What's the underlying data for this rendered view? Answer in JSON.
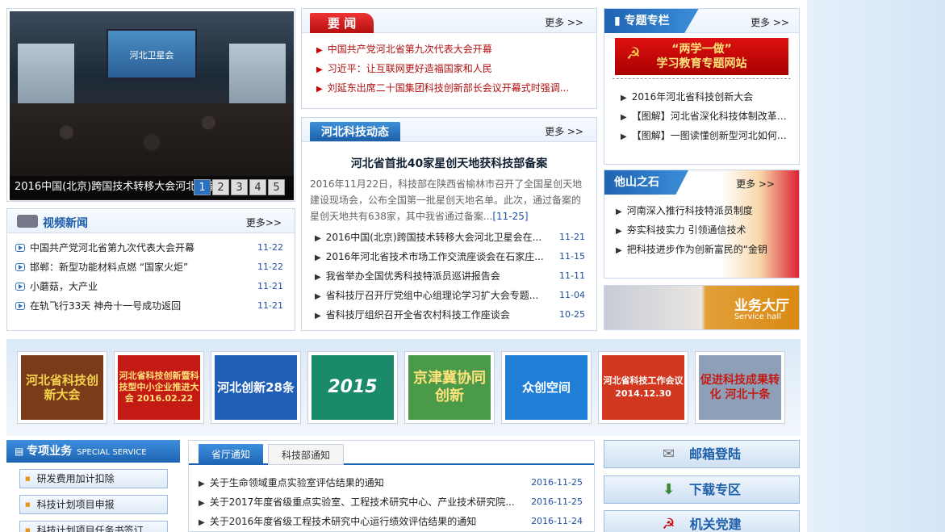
{
  "slideshow": {
    "stage_text": "河北卫星会",
    "caption": "2016中国(北京)跨国技术转移大会河北卫星会",
    "pages": [
      "1",
      "2",
      "3",
      "4",
      "5"
    ],
    "current": 1
  },
  "news": {
    "title": "要 闻",
    "more": "更多 >>",
    "items": [
      "中国共产党河北省第九次代表大会开幕",
      "习近平：让互联网更好造福国家和人民",
      "刘延东出席二十国集团科技创新部长会议开幕式时强调..."
    ]
  },
  "dynamics": {
    "title": "河北科技动态",
    "more": "更多 >>",
    "headline": "河北省首批40家星创天地获科技部备案",
    "summary": "2016年11月22日，科技部在陕西省榆林市召开了全国星创天地建设现场会，公布全国第一批星创天地名单。此次，通过备案的星创天地共有638家，其中我省通过备案...",
    "summary_date": "[11-25]",
    "items": [
      {
        "text": "2016中国(北京)跨国技术转移大会河北卫星会在...",
        "date": "11-21"
      },
      {
        "text": "2016年河北省技术市场工作交流座谈会在石家庄...",
        "date": "11-15"
      },
      {
        "text": "我省举办全国优秀科技特派员巡讲报告会",
        "date": "11-11"
      },
      {
        "text": "省科技厅召开厅党组中心组理论学习扩大会专题...",
        "date": "11-04"
      },
      {
        "text": "省科技厅组织召开全省农村科技工作座谈会",
        "date": "10-25"
      }
    ]
  },
  "video": {
    "title": "视频新闻",
    "more": "更多>>",
    "items": [
      {
        "text": "中国共产党河北省第九次代表大会开幕",
        "date": "11-22"
      },
      {
        "text": "邯郸：新型功能材料点燃 “国家火炬”",
        "date": "11-22"
      },
      {
        "text": "小蘑菇，大产业",
        "date": "11-21"
      },
      {
        "text": "在轨飞行33天 神舟十一号成功返回",
        "date": "11-21"
      }
    ]
  },
  "topic": {
    "title": "专题专栏",
    "banner_line1": "“两学一做”",
    "banner_line2": "学习教育专题网站",
    "more": "更多 >>",
    "items": [
      "2016年河北省科技创新大会",
      "【图解】河北省深化科技体制改革实...",
      "【图解】一图读懂创新型河北如何建..."
    ]
  },
  "stone": {
    "title": "他山之石",
    "more": "更多 >>",
    "items": [
      "河南深入推行科技特派员制度",
      "夯实科技实力 引领通信技术",
      "把科技进步作为创新富民的“金钥"
    ]
  },
  "hall": {
    "title": "业务大厅",
    "subtitle": "Service hall"
  },
  "thumbs": [
    {
      "text": "河北省科技创新大会",
      "bg": "#7a3b1b"
    },
    {
      "text": "河北省科技创新暨科技型中小企业推进大会 2016.02.22",
      "bg": "#c41a14"
    },
    {
      "text": "河北创新28条",
      "bg": "#1f5fb8"
    },
    {
      "text": "2015",
      "bg": "#1a8a6a"
    },
    {
      "text": "京津冀协同创新",
      "bg": "#4a9a4a"
    },
    {
      "text": "众创空间",
      "bg": "#1f7fd6"
    },
    {
      "text": "河北省科技工作会议 2014.12.30",
      "bg": "#d2381f"
    },
    {
      "text": "促进科技成果转化 河北十条",
      "bg": "#8ea0b8"
    }
  ],
  "special": {
    "title": "专项业务",
    "subtitle": "SPECIAL SERVICE",
    "items": [
      "研发费用加计扣除",
      "科技计划项目申报",
      "科技计划项目任务书签订"
    ]
  },
  "notices": {
    "tab_active": "省厅通知",
    "tab_inactive": "科技部通知",
    "items": [
      {
        "text": "关于生命领域重点实验室评估结果的通知",
        "date": "2016-11-25"
      },
      {
        "text": "关于2017年度省级重点实验室、工程技术研究中心、产业技术研究院...",
        "date": "2016-11-25"
      },
      {
        "text": "关于2016年度省级工程技术研究中心运行绩效评估结果的通知",
        "date": "2016-11-24"
      }
    ]
  },
  "services": [
    {
      "label": "邮箱登陆",
      "icon": "envelope-icon"
    },
    {
      "label": "下载专区",
      "icon": "download-icon"
    },
    {
      "label": "机关党建",
      "icon": "party-emblem-icon"
    }
  ]
}
